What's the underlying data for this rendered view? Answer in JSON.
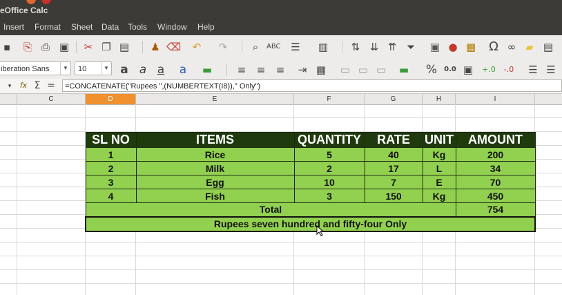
{
  "window": {
    "title": "eOffice Calc"
  },
  "menu": [
    "Insert",
    "Format",
    "Sheet",
    "Data",
    "Tools",
    "Window",
    "Help"
  ],
  "format_bar": {
    "font_name": "iberation Sans",
    "font_size": "10"
  },
  "formula_bar": {
    "fx_symbol": "fx",
    "sum_symbol": "Σ",
    "equals_symbol": "=",
    "formula": "=CONCATENATE(\"Rupees \",(NUMBERTEXT(I8)),\" Only\")"
  },
  "columns": [
    "C",
    "D",
    "E",
    "F",
    "G",
    "H",
    "I"
  ],
  "selected_column": "D",
  "table": {
    "headers": [
      "SL NO",
      "ITEMS",
      "QUANTITY",
      "RATE",
      "UNIT",
      "AMOUNT"
    ],
    "rows": [
      [
        "1",
        "Rice",
        "5",
        "40",
        "Kg",
        "200"
      ],
      [
        "2",
        "Milk",
        "2",
        "17",
        "L",
        "34"
      ],
      [
        "3",
        "Egg",
        "10",
        "7",
        "E",
        "70"
      ],
      [
        "4",
        "Fish",
        "3",
        "150",
        "Kg",
        "450"
      ]
    ],
    "total_label": "Total",
    "total_value": "754",
    "amount_in_words": "Rupees seven hundred and fifty-four Only"
  },
  "colors": {
    "header_bg": "#1f3b0e",
    "cell_bg": "#92d050",
    "selected_col": "#f0902e"
  }
}
